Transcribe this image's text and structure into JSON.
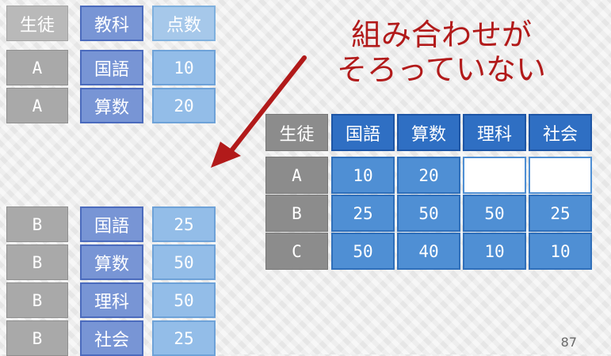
{
  "long_table": {
    "headers": [
      "生徒",
      "教科",
      "点数"
    ],
    "rows": [
      {
        "student": "A",
        "subject": "国語",
        "score": "10"
      },
      {
        "student": "A",
        "subject": "算数",
        "score": "20"
      },
      {
        "student": "B",
        "subject": "国語",
        "score": "25"
      },
      {
        "student": "B",
        "subject": "算数",
        "score": "50"
      },
      {
        "student": "B",
        "subject": "理科",
        "score": "50"
      },
      {
        "student": "B",
        "subject": "社会",
        "score": "25"
      }
    ]
  },
  "callout": {
    "line1": "組み合わせが",
    "line2": "そろっていない",
    "color": "#b21a1a"
  },
  "wide_table": {
    "headers": [
      "生徒",
      "国語",
      "算数",
      "理科",
      "社会"
    ],
    "rows": [
      [
        "A",
        "10",
        "20",
        "",
        ""
      ],
      [
        "B",
        "25",
        "50",
        "50",
        "25"
      ],
      [
        "C",
        "50",
        "40",
        "10",
        "10"
      ]
    ]
  },
  "page_number": "87"
}
